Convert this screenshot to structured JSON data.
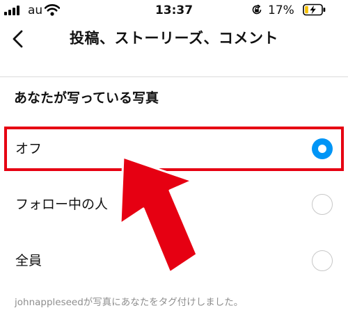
{
  "status_bar": {
    "carrier": "au",
    "time": "13:37",
    "battery_percent": "17%",
    "icons": [
      "signal-icon",
      "wifi-icon",
      "orientation-lock-icon",
      "battery-charging-icon"
    ]
  },
  "header": {
    "back_icon": "chevron-left-icon",
    "title": "投稿、ストーリーズ、コメント"
  },
  "section": {
    "title": "あなたが写っている写真",
    "options": [
      {
        "label": "オフ",
        "selected": true
      },
      {
        "label": "フォロー中の人",
        "selected": false
      },
      {
        "label": "全員",
        "selected": false
      }
    ],
    "footer_note": "johnappleseedが写真にあなたをタグ付けしました。"
  },
  "annotation": {
    "highlight_color": "#e60012",
    "arrow_color": "#e60012"
  },
  "colors": {
    "accent": "#0095f6",
    "text": "#111111",
    "secondary_text": "#8e8e8e",
    "divider": "#dbdbdb"
  }
}
